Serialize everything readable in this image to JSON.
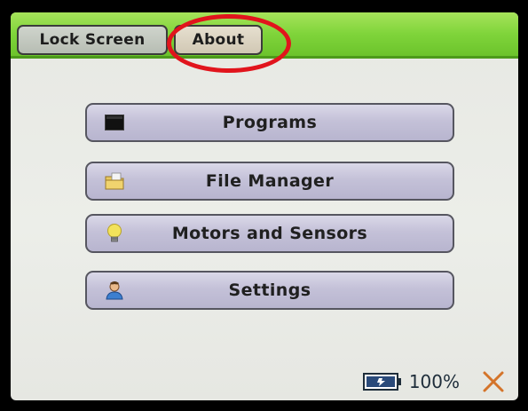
{
  "tabs": {
    "lock_screen": "Lock Screen",
    "about": "About"
  },
  "menu": [
    {
      "label": "Programs",
      "icon": "terminal-icon"
    },
    {
      "label": "File Manager",
      "icon": "folder-icon"
    },
    {
      "label": "Motors and Sensors",
      "icon": "lightbulb-icon"
    },
    {
      "label": "Settings",
      "icon": "user-icon"
    }
  ],
  "status": {
    "battery_percent": "100%",
    "battery_level": 1.0,
    "close_icon": "close-icon"
  },
  "colors": {
    "topbar_green": "#7fd43a",
    "highlight_red": "#e1141c",
    "button_lavender": "#c4c1d8",
    "close_orange": "#d4742a"
  }
}
